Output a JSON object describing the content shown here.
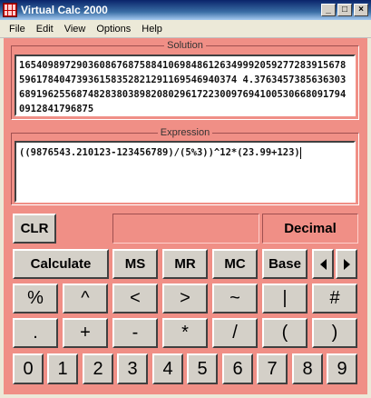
{
  "window": {
    "title": "Virtual Calc 2000",
    "controls": [
      "_",
      "□",
      "×"
    ]
  },
  "menu": [
    "File",
    "Edit",
    "View",
    "Options",
    "Help"
  ],
  "solution": {
    "label": "Solution",
    "value": "16540989729036086768758841069848612634999205927728391567859617840473936158352821291169546940374 4.37634573856363036891962556874828380389820802961722300976941005306680917940912841796875"
  },
  "expression": {
    "label": "Expression",
    "value": "((9876543.210123-123456789)/(5%3))^12*(23.99+123)"
  },
  "controls": {
    "clear": "CLR",
    "mode": "Decimal",
    "calculate": "Calculate",
    "ms": "MS",
    "mr": "MR",
    "mc": "MC",
    "base": "Base"
  },
  "operators_row1": [
    "%",
    "^",
    "<",
    ">",
    "~",
    "|",
    "#"
  ],
  "operators_row2": [
    ".",
    "+",
    "-",
    "*",
    "/",
    "(",
    ")"
  ],
  "digits": [
    "0",
    "1",
    "2",
    "3",
    "4",
    "5",
    "6",
    "7",
    "8",
    "9"
  ],
  "colors": {
    "background": "#f08f86",
    "button": "#d4d0c8",
    "titlebar": "#0a246a"
  }
}
